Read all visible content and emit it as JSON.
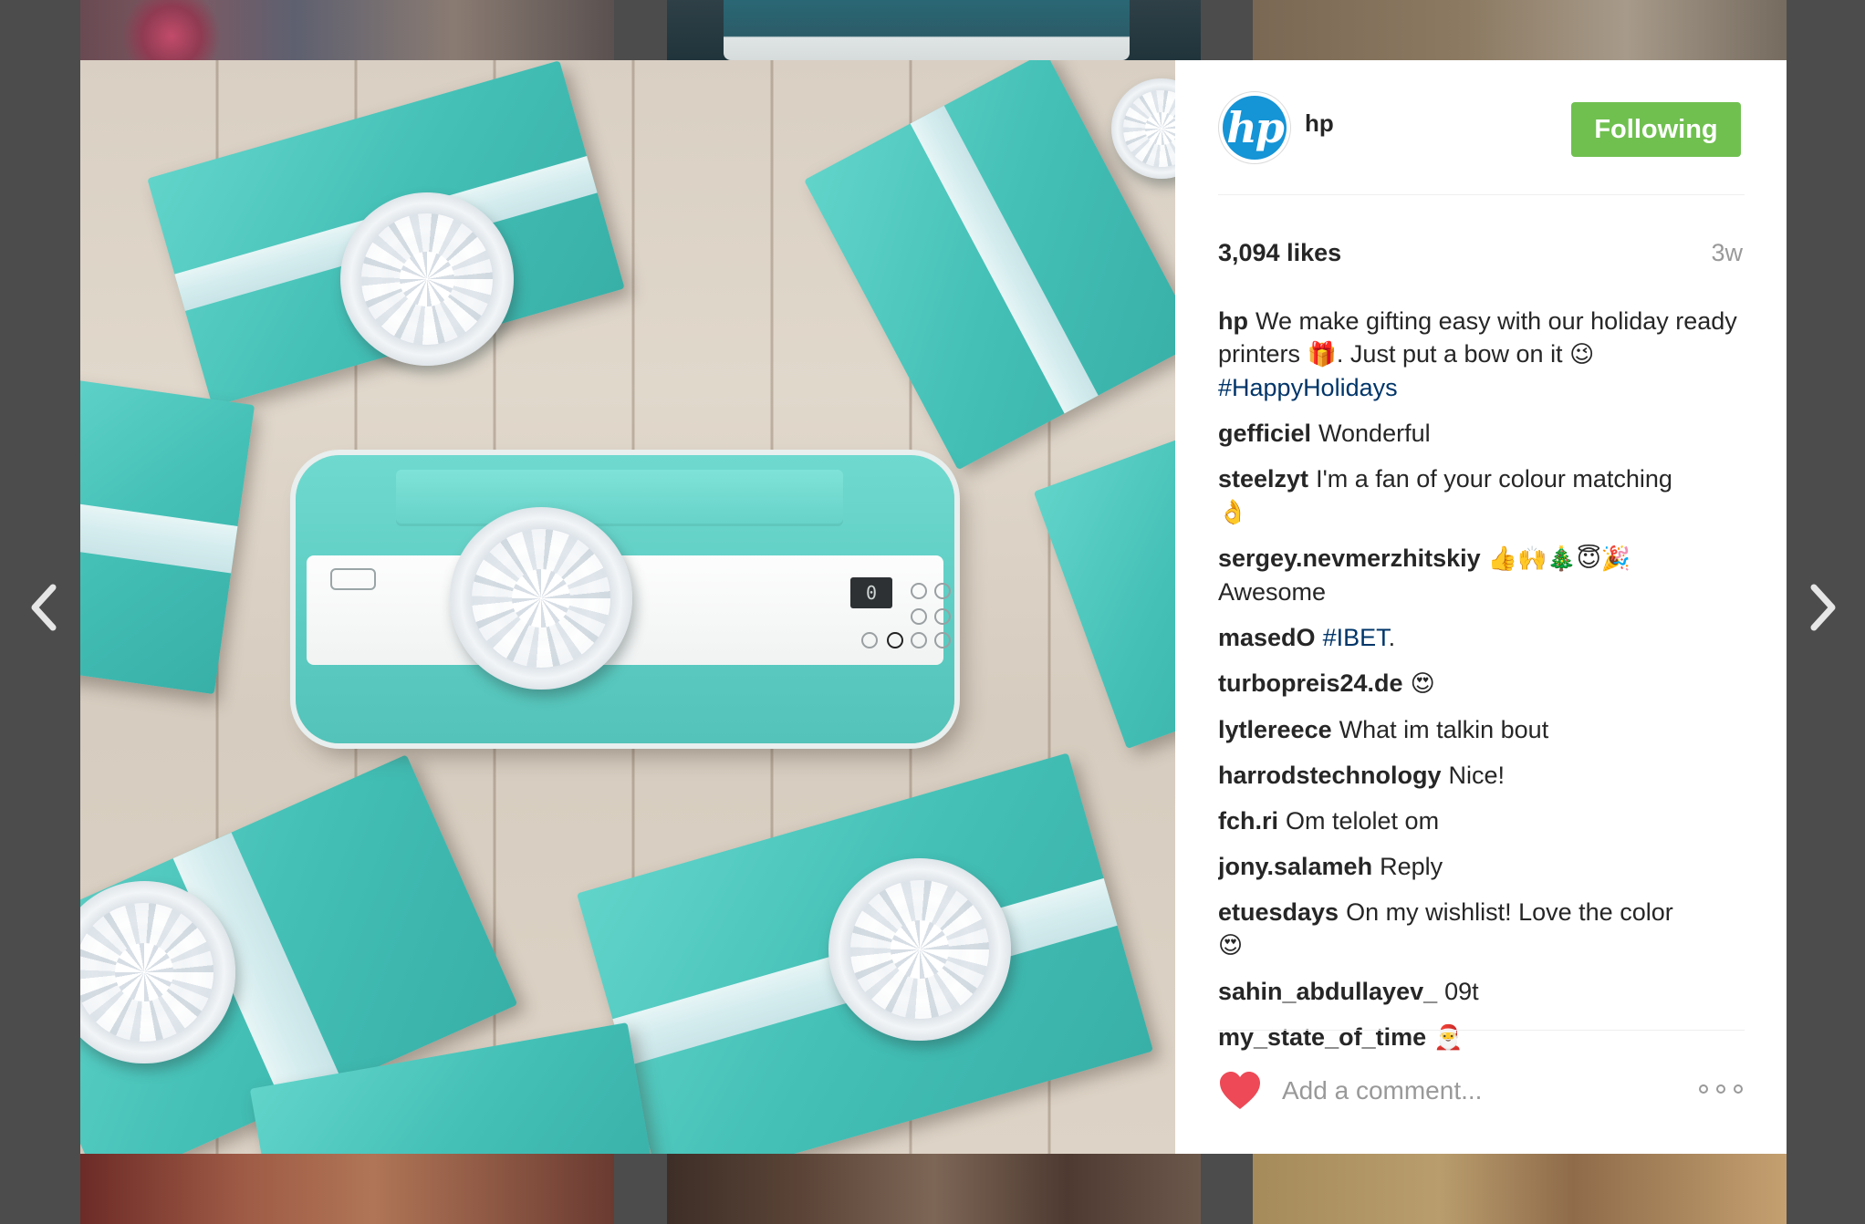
{
  "post": {
    "username": "hp",
    "avatar_text": "hp",
    "follow_label": "Following",
    "likes": "3,094 likes",
    "age": "3w",
    "caption": {
      "user": "hp",
      "text_1": "We make gifting easy with our holiday ready printers",
      "emoji_1": "🎁",
      "text_2": ". Just put a bow on it",
      "emoji_2": "😉",
      "hashtag": "#HappyHolidays"
    },
    "comments": [
      {
        "user": "gefficiel",
        "text": "Wonderful"
      },
      {
        "user": "steelzyt",
        "text": "I'm a fan of your colour matching",
        "emoji": "👌"
      },
      {
        "user": "sergey.nevmerzhitskiy",
        "emoji": "👍🙌🎄😇🎉",
        "text": "Awesome"
      },
      {
        "user": "masedO",
        "hashtag": "#IBET",
        "text": "."
      },
      {
        "user": "turbopreis24.de",
        "emoji": "😍"
      },
      {
        "user": "lytlereece",
        "text": "What im talkin bout"
      },
      {
        "user": "harrodstechnology",
        "text": "Nice!"
      },
      {
        "user": "fch.ri",
        "text": "Om telolet om"
      },
      {
        "user": "jony.salameh",
        "text": "Reply"
      },
      {
        "user": "etuesdays",
        "text": "On my wishlist! Love the color",
        "emoji": "😍"
      },
      {
        "user": "sahin_abdullayev_",
        "text": "09t"
      },
      {
        "user": "my_state_of_time",
        "emoji": "🎅"
      }
    ],
    "comment_placeholder": "Add a comment...",
    "printer_lcd": "0"
  },
  "icons": {
    "prev": "chevron-left-icon",
    "next": "chevron-right-icon",
    "like": "heart-icon",
    "more": "more-options-icon"
  },
  "colors": {
    "follow_button": "#70c050",
    "heart": "#ed4956",
    "hashtag": "#003569",
    "avatar_bg": "#1594d6"
  }
}
